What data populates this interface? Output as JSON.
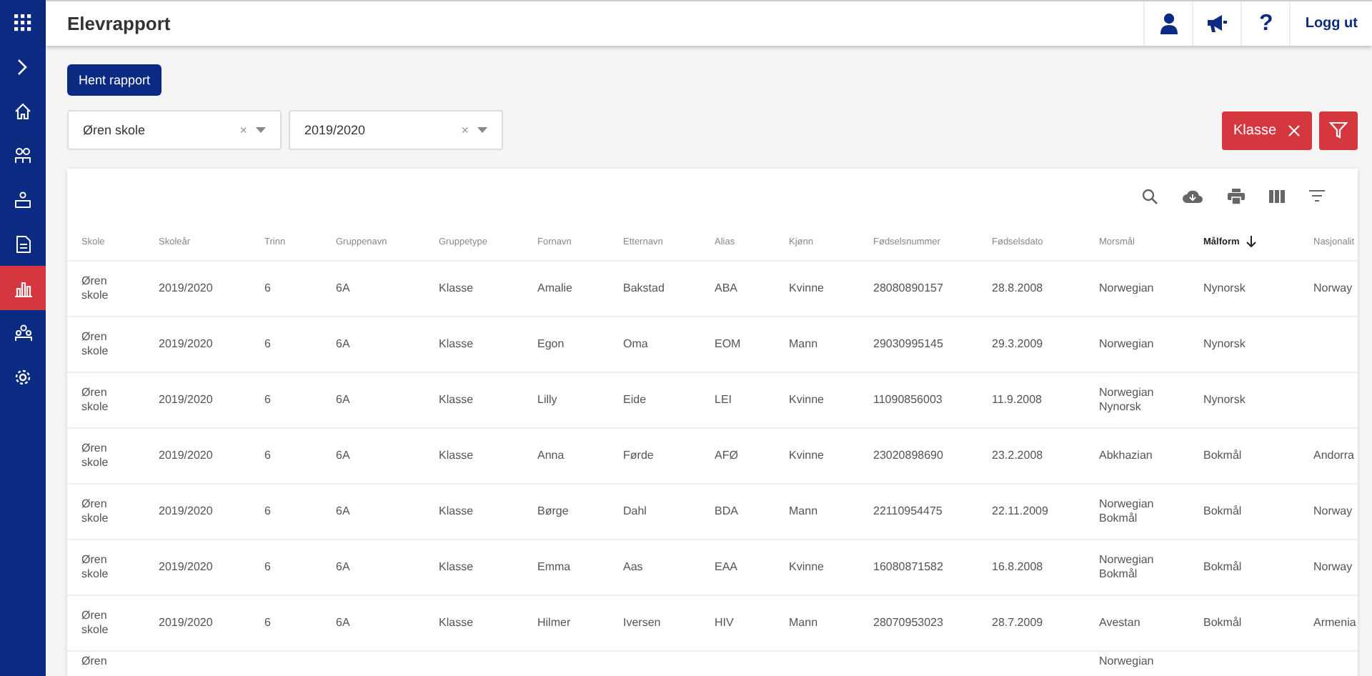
{
  "sidebar": {
    "items": [
      {
        "selected": false
      },
      {
        "selected": false
      },
      {
        "selected": false
      },
      {
        "selected": false
      },
      {
        "selected": false
      },
      {
        "selected": false
      },
      {
        "selected": true
      },
      {
        "selected": false
      },
      {
        "selected": false
      }
    ]
  },
  "header": {
    "title": "Elevrapport",
    "actions": [
      {
        "kind": "user"
      },
      {
        "kind": "megaphone"
      },
      {
        "kind": "help",
        "label": "?"
      },
      {
        "kind": "text",
        "label": "Logg ut"
      }
    ]
  },
  "fetch_button": "Hent rapport",
  "filters": [
    {
      "value": "Øren skole",
      "clear": "×"
    },
    {
      "value": "2019/2020",
      "clear": "×"
    }
  ],
  "chip": {
    "label": "Klasse"
  },
  "table": {
    "columns": [
      {
        "label": "Skole",
        "sorted": false
      },
      {
        "label": "Skoleår",
        "sorted": false
      },
      {
        "label": "Trinn",
        "sorted": false
      },
      {
        "label": "Gruppenavn",
        "sorted": false
      },
      {
        "label": "Gruppetype",
        "sorted": false
      },
      {
        "label": "Fornavn",
        "sorted": false
      },
      {
        "label": "Etternavn",
        "sorted": false
      },
      {
        "label": "Alias",
        "sorted": false
      },
      {
        "label": "Kjønn",
        "sorted": false
      },
      {
        "label": "Fødselsnummer",
        "sorted": false
      },
      {
        "label": "Fødselsdato",
        "sorted": false
      },
      {
        "label": "Morsmål",
        "sorted": false
      },
      {
        "label": "Målform",
        "sorted": true
      },
      {
        "label": "Nasjonalit",
        "sorted": false
      }
    ],
    "rows": [
      [
        "Øren skole",
        "2019/2020",
        "6",
        "6A",
        "Klasse",
        "Amalie",
        "Bakstad",
        "ABA",
        "Kvinne",
        "28080890157",
        "28.8.2008",
        "Norwegian",
        "Nynorsk",
        "Norway"
      ],
      [
        "Øren skole",
        "2019/2020",
        "6",
        "6A",
        "Klasse",
        "Egon",
        "Oma",
        "EOM",
        "Mann",
        "29030995145",
        "29.3.2009",
        "Norwegian",
        "Nynorsk",
        null
      ],
      [
        "Øren skole",
        "2019/2020",
        "6",
        "6A",
        "Klasse",
        "Lilly",
        "Eide",
        "LEI",
        "Kvinne",
        "11090856003",
        "11.9.2008",
        "Norwegian Nynorsk",
        "Nynorsk",
        null
      ],
      [
        "Øren skole",
        "2019/2020",
        "6",
        "6A",
        "Klasse",
        "Anna",
        "Førde",
        "AFØ",
        "Kvinne",
        "23020898690",
        "23.2.2008",
        "Abkhazian",
        "Bokmål",
        "Andorra"
      ],
      [
        "Øren skole",
        "2019/2020",
        "6",
        "6A",
        "Klasse",
        "Børge",
        "Dahl",
        "BDA",
        "Mann",
        "22110954475",
        "22.11.2009",
        "Norwegian Bokmål",
        "Bokmål",
        "Norway"
      ],
      [
        "Øren skole",
        "2019/2020",
        "6",
        "6A",
        "Klasse",
        "Emma",
        "Aas",
        "EAA",
        "Kvinne",
        "16080871582",
        "16.8.2008",
        "Norwegian Bokmål",
        "Bokmål",
        "Norway"
      ],
      [
        "Øren skole",
        "2019/2020",
        "6",
        "6A",
        "Klasse",
        "Hilmer",
        "Iversen",
        "HIV",
        "Mann",
        "28070953023",
        "28.7.2009",
        "Avestan",
        "Bokmål",
        "Armenia"
      ],
      [
        "Øren",
        null,
        null,
        null,
        null,
        null,
        null,
        null,
        null,
        null,
        null,
        "Norwegian",
        null,
        null
      ]
    ]
  }
}
